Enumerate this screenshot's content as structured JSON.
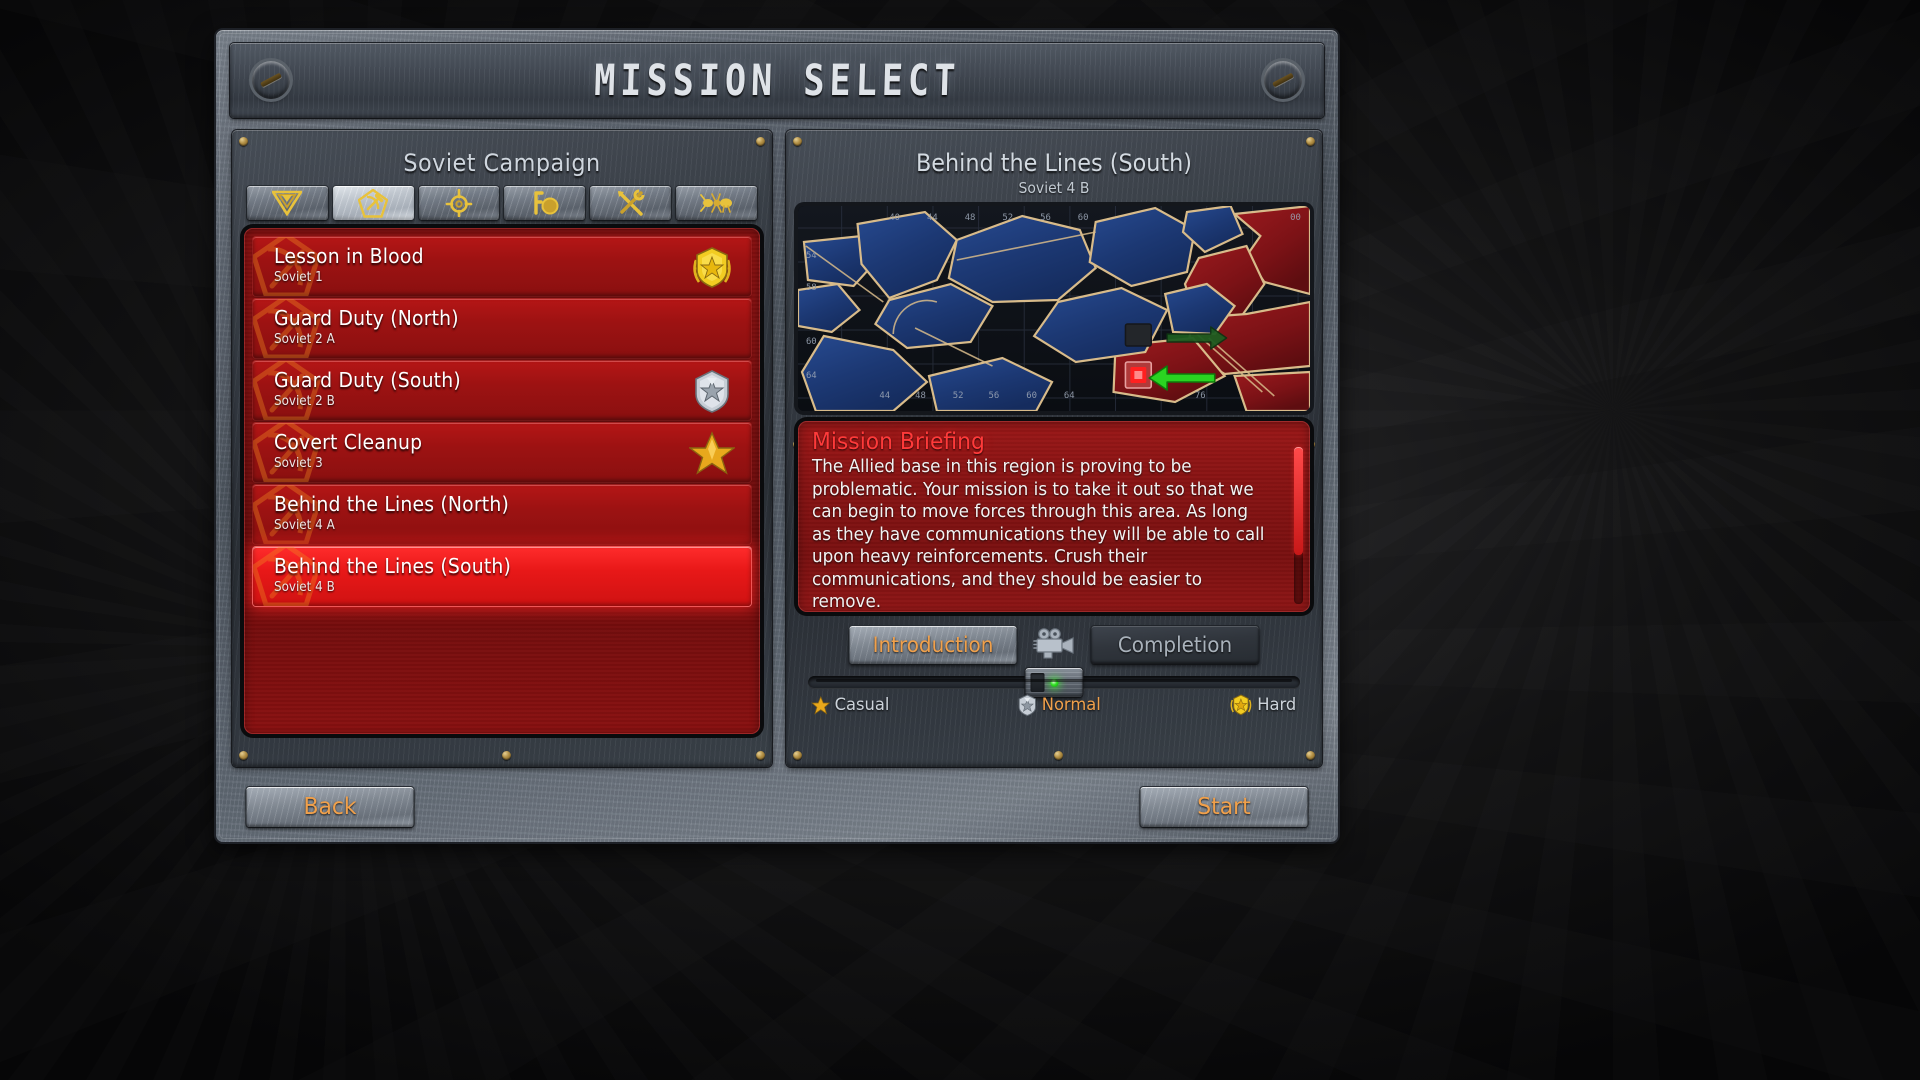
{
  "window": {
    "title": "MISSION SELECT"
  },
  "left_panel": {
    "heading": "Soviet Campaign",
    "tabs": [
      {
        "name": "tab-allied",
        "icon": "allied-triangle-icon",
        "active": false
      },
      {
        "name": "tab-soviet",
        "icon": "soviet-hammer-sickle-icon",
        "active": true
      },
      {
        "name": "tab-yuri",
        "icon": "target-crosshair-icon",
        "active": false
      },
      {
        "name": "tab-challenge",
        "icon": "key-icon",
        "active": false
      },
      {
        "name": "tab-mods",
        "icon": "crossed-tools-icon",
        "active": false
      },
      {
        "name": "tab-ants",
        "icon": "ant-icon",
        "active": false
      }
    ],
    "missions": [
      {
        "title": "Lesson in Blood",
        "code": "Soviet 1",
        "medal": "gold-wreath-shield",
        "selected": false
      },
      {
        "title": "Guard Duty (North)",
        "code": "Soviet 2 A",
        "medal": "none",
        "selected": false
      },
      {
        "title": "Guard Duty (South)",
        "code": "Soviet 2 B",
        "medal": "silver-shield",
        "selected": false
      },
      {
        "title": "Covert Cleanup",
        "code": "Soviet 3",
        "medal": "gold-star",
        "selected": false
      },
      {
        "title": "Behind the Lines (North)",
        "code": "Soviet 4 A",
        "medal": "none",
        "selected": false
      },
      {
        "title": "Behind the Lines (South)",
        "code": "Soviet 4 B",
        "medal": "none",
        "selected": true
      }
    ]
  },
  "right_panel": {
    "mission_title": "Behind the Lines (South)",
    "mission_code": "Soviet 4 B",
    "map": {
      "grid_labels_top": [
        "40",
        "44",
        "48",
        "52",
        "56",
        "60"
      ],
      "grid_labels_left": [
        "54",
        "58",
        "60",
        "64"
      ],
      "grid_labels_bottom": [
        "44",
        "48",
        "52",
        "56",
        "60",
        "64",
        "76"
      ],
      "allied_color": "#1b3a7a",
      "soviet_color": "#8a1216",
      "border_color": "#d8bb8a",
      "objective_marker_color": "#ff2020",
      "arrow_primary_color": "#2ad421",
      "arrow_secondary_color": "#1d5c20"
    },
    "briefing": {
      "title": "Mission Briefing",
      "body": "The Allied base in this region is proving to be problematic. Your mission is to take it out so that we can begin to move forces through this area. As long as they have communications they will be able to call upon heavy reinforcements. Crush their communications, and they should be easier to remove."
    },
    "video_buttons": [
      {
        "label": "Introduction",
        "enabled": true
      },
      {
        "label": "Completion",
        "enabled": false
      }
    ],
    "video_icon": "film-camera-icon",
    "difficulty": {
      "selected": "Normal",
      "options": [
        {
          "label": "Casual",
          "icon": "gold-star-icon"
        },
        {
          "label": "Normal",
          "icon": "silver-shield-icon"
        },
        {
          "label": "Hard",
          "icon": "gold-wreath-icon"
        }
      ]
    }
  },
  "footer": {
    "back_label": "Back",
    "start_label": "Start"
  }
}
